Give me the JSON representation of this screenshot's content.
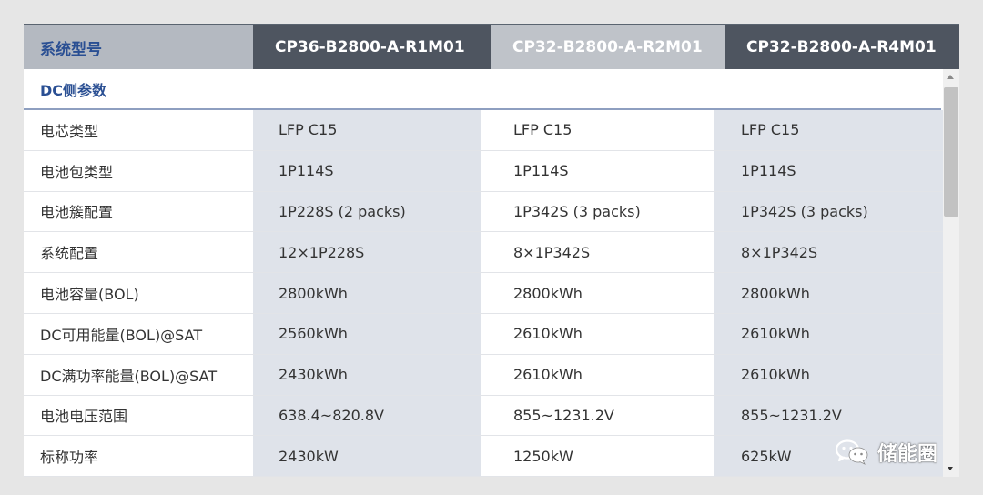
{
  "header": {
    "label": "系统型号",
    "models": [
      "CP36-B2800-A-R1M01",
      "CP32-B2800-A-R2M01",
      "CP32-B2800-A-R4M01"
    ]
  },
  "section": {
    "title": "DC侧参数"
  },
  "rows": [
    {
      "label": "电芯类型",
      "values": [
        "LFP C15",
        "LFP C15",
        "LFP C15"
      ]
    },
    {
      "label": "电池包类型",
      "values": [
        "1P114S",
        "1P114S",
        "1P114S"
      ]
    },
    {
      "label": "电池簇配置",
      "values": [
        "1P228S (2 packs)",
        "1P342S (3 packs)",
        "1P342S (3 packs)"
      ]
    },
    {
      "label": "系统配置",
      "values": [
        "12×1P228S",
        "8×1P342S",
        "8×1P342S"
      ]
    },
    {
      "label": "电池容量(BOL)",
      "values": [
        "2800kWh",
        "2800kWh",
        "2800kWh"
      ]
    },
    {
      "label": "DC可用能量(BOL)@SAT",
      "values": [
        "2560kWh",
        "2610kWh",
        "2610kWh"
      ]
    },
    {
      "label": "DC满功率能量(BOL)@SAT",
      "values": [
        "2430kWh",
        "2610kWh",
        "2610kWh"
      ]
    },
    {
      "label": "电池电压范围",
      "values": [
        "638.4~820.8V",
        "855~1231.2V",
        "855~1231.2V"
      ]
    },
    {
      "label": "标称功率",
      "values": [
        "2430kW",
        "1250kW",
        "625kW"
      ]
    }
  ],
  "watermark": {
    "text": "储能圈",
    "icon": "wechat-icon"
  }
}
